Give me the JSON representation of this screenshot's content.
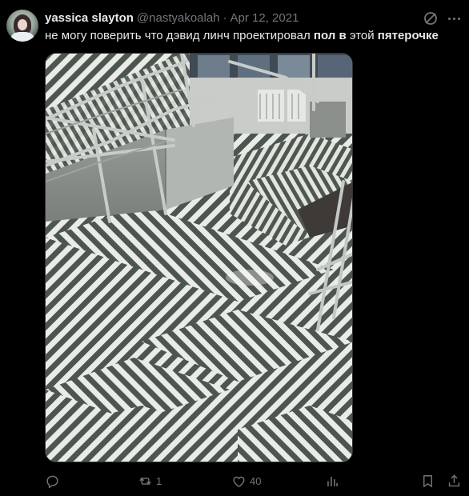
{
  "tweet": {
    "display_name": "yassica slayton",
    "handle": "@nastyakoalah",
    "separator": "·",
    "date": "Apr 12, 2021",
    "text_parts": {
      "part1": "не могу поверить что дэвид линч проектировал ",
      "bold1": "пол в",
      "part2": " этой ",
      "bold2": "пятерочке"
    },
    "image_description_icon": "photo"
  },
  "actions": {
    "reply_count": "",
    "repost_count": "1",
    "like_count": "40",
    "views_count": ""
  },
  "icons": {
    "reply": "reply-icon",
    "repost": "repost-icon",
    "like": "heart-icon",
    "views": "views-icon",
    "bookmark": "bookmark-icon",
    "share": "share-icon",
    "grok": "grok-icon",
    "more": "more-icon"
  },
  "colors": {
    "background": "#000000",
    "text": "#e7e9ea",
    "muted": "#71767b",
    "border": "#2f3336"
  }
}
